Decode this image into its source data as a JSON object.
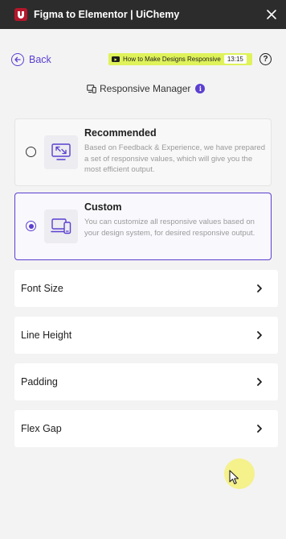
{
  "titlebar": {
    "title": "Figma to Elementor | UiChemy",
    "logo_icon": "uichemy-logo-icon",
    "close_icon": "close-icon",
    "background": "#2c2c2c"
  },
  "nav": {
    "back_label": "Back",
    "video_title": "How to Make Designs Responsive",
    "video_duration": "13:15",
    "help_label": "?"
  },
  "section": {
    "title": "Responsive Manager",
    "info_label": "i"
  },
  "options": [
    {
      "title": "Recommended",
      "description": "Based on Feedback & Experience, we have prepared a set of responsive values, which will give you the most efficient output.",
      "selected": false,
      "icon": "responsive-shrink-icon"
    },
    {
      "title": "Custom",
      "description": "You can customize all responsive values based on your design system, for desired responsive output.",
      "selected": true,
      "icon": "devices-icon"
    }
  ],
  "settings": [
    {
      "label": "Font Size"
    },
    {
      "label": "Line Height"
    },
    {
      "label": "Padding"
    },
    {
      "label": "Flex Gap"
    }
  ],
  "colors": {
    "accent": "#5b3fd0",
    "badge": "#dff25a",
    "brand": "#b5162b"
  }
}
